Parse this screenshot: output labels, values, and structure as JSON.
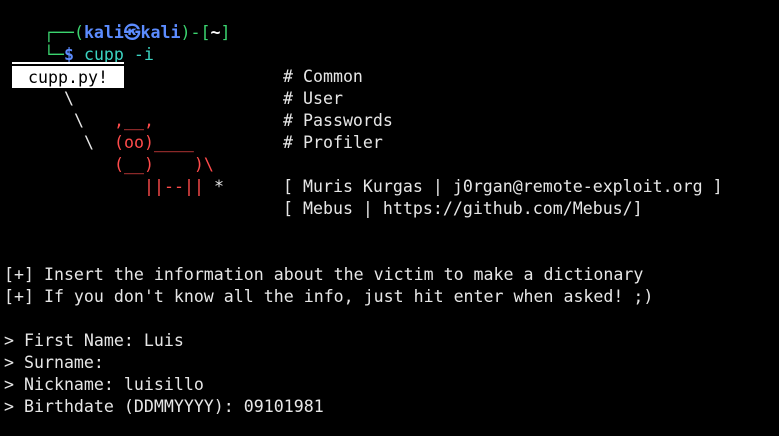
{
  "prompt": {
    "corner_top": "┌──(",
    "user": "kali",
    "at_symbol": "㉿",
    "host": "kali",
    "mid": ")-[",
    "cwd": "~",
    "end": "]",
    "corner_bottom": "└─",
    "dollar": "$",
    "command": "cupp",
    "argument": "-i"
  },
  "banner": {
    "box_label": "cupp.py!",
    "art_lines": [
      "\\",
      " \\      ,__,",
      "  \\     (oo)____",
      "        (__)    )\\",
      "           ||--|| *"
    ],
    "menu": [
      "# Common",
      "# User",
      "# Passwords",
      "# Profiler"
    ],
    "credits": [
      "[ Muris Kurgas | j0rgan@remote-exploit.org ]",
      "[ Mebus | https://github.com/Mebus/]"
    ]
  },
  "info_lines": [
    "[+] Insert the information about the victim to make a dictionary",
    "[+] If you don't know all the info, just hit enter when asked! ;)"
  ],
  "form": [
    {
      "label": "> First Name: ",
      "value": "Luis"
    },
    {
      "label": "> Surname: ",
      "value": ""
    },
    {
      "label": "> Nickname: ",
      "value": "luisillo"
    },
    {
      "label": "> Birthdate (DDMMYYYY): ",
      "value": "09101981"
    }
  ],
  "colors": {
    "prompt_green": "#3bd46f",
    "prompt_blue": "#5c8cff",
    "command_cyan": "#3bd4c2",
    "art_red": "#ff4b4b",
    "background": "#000000"
  }
}
